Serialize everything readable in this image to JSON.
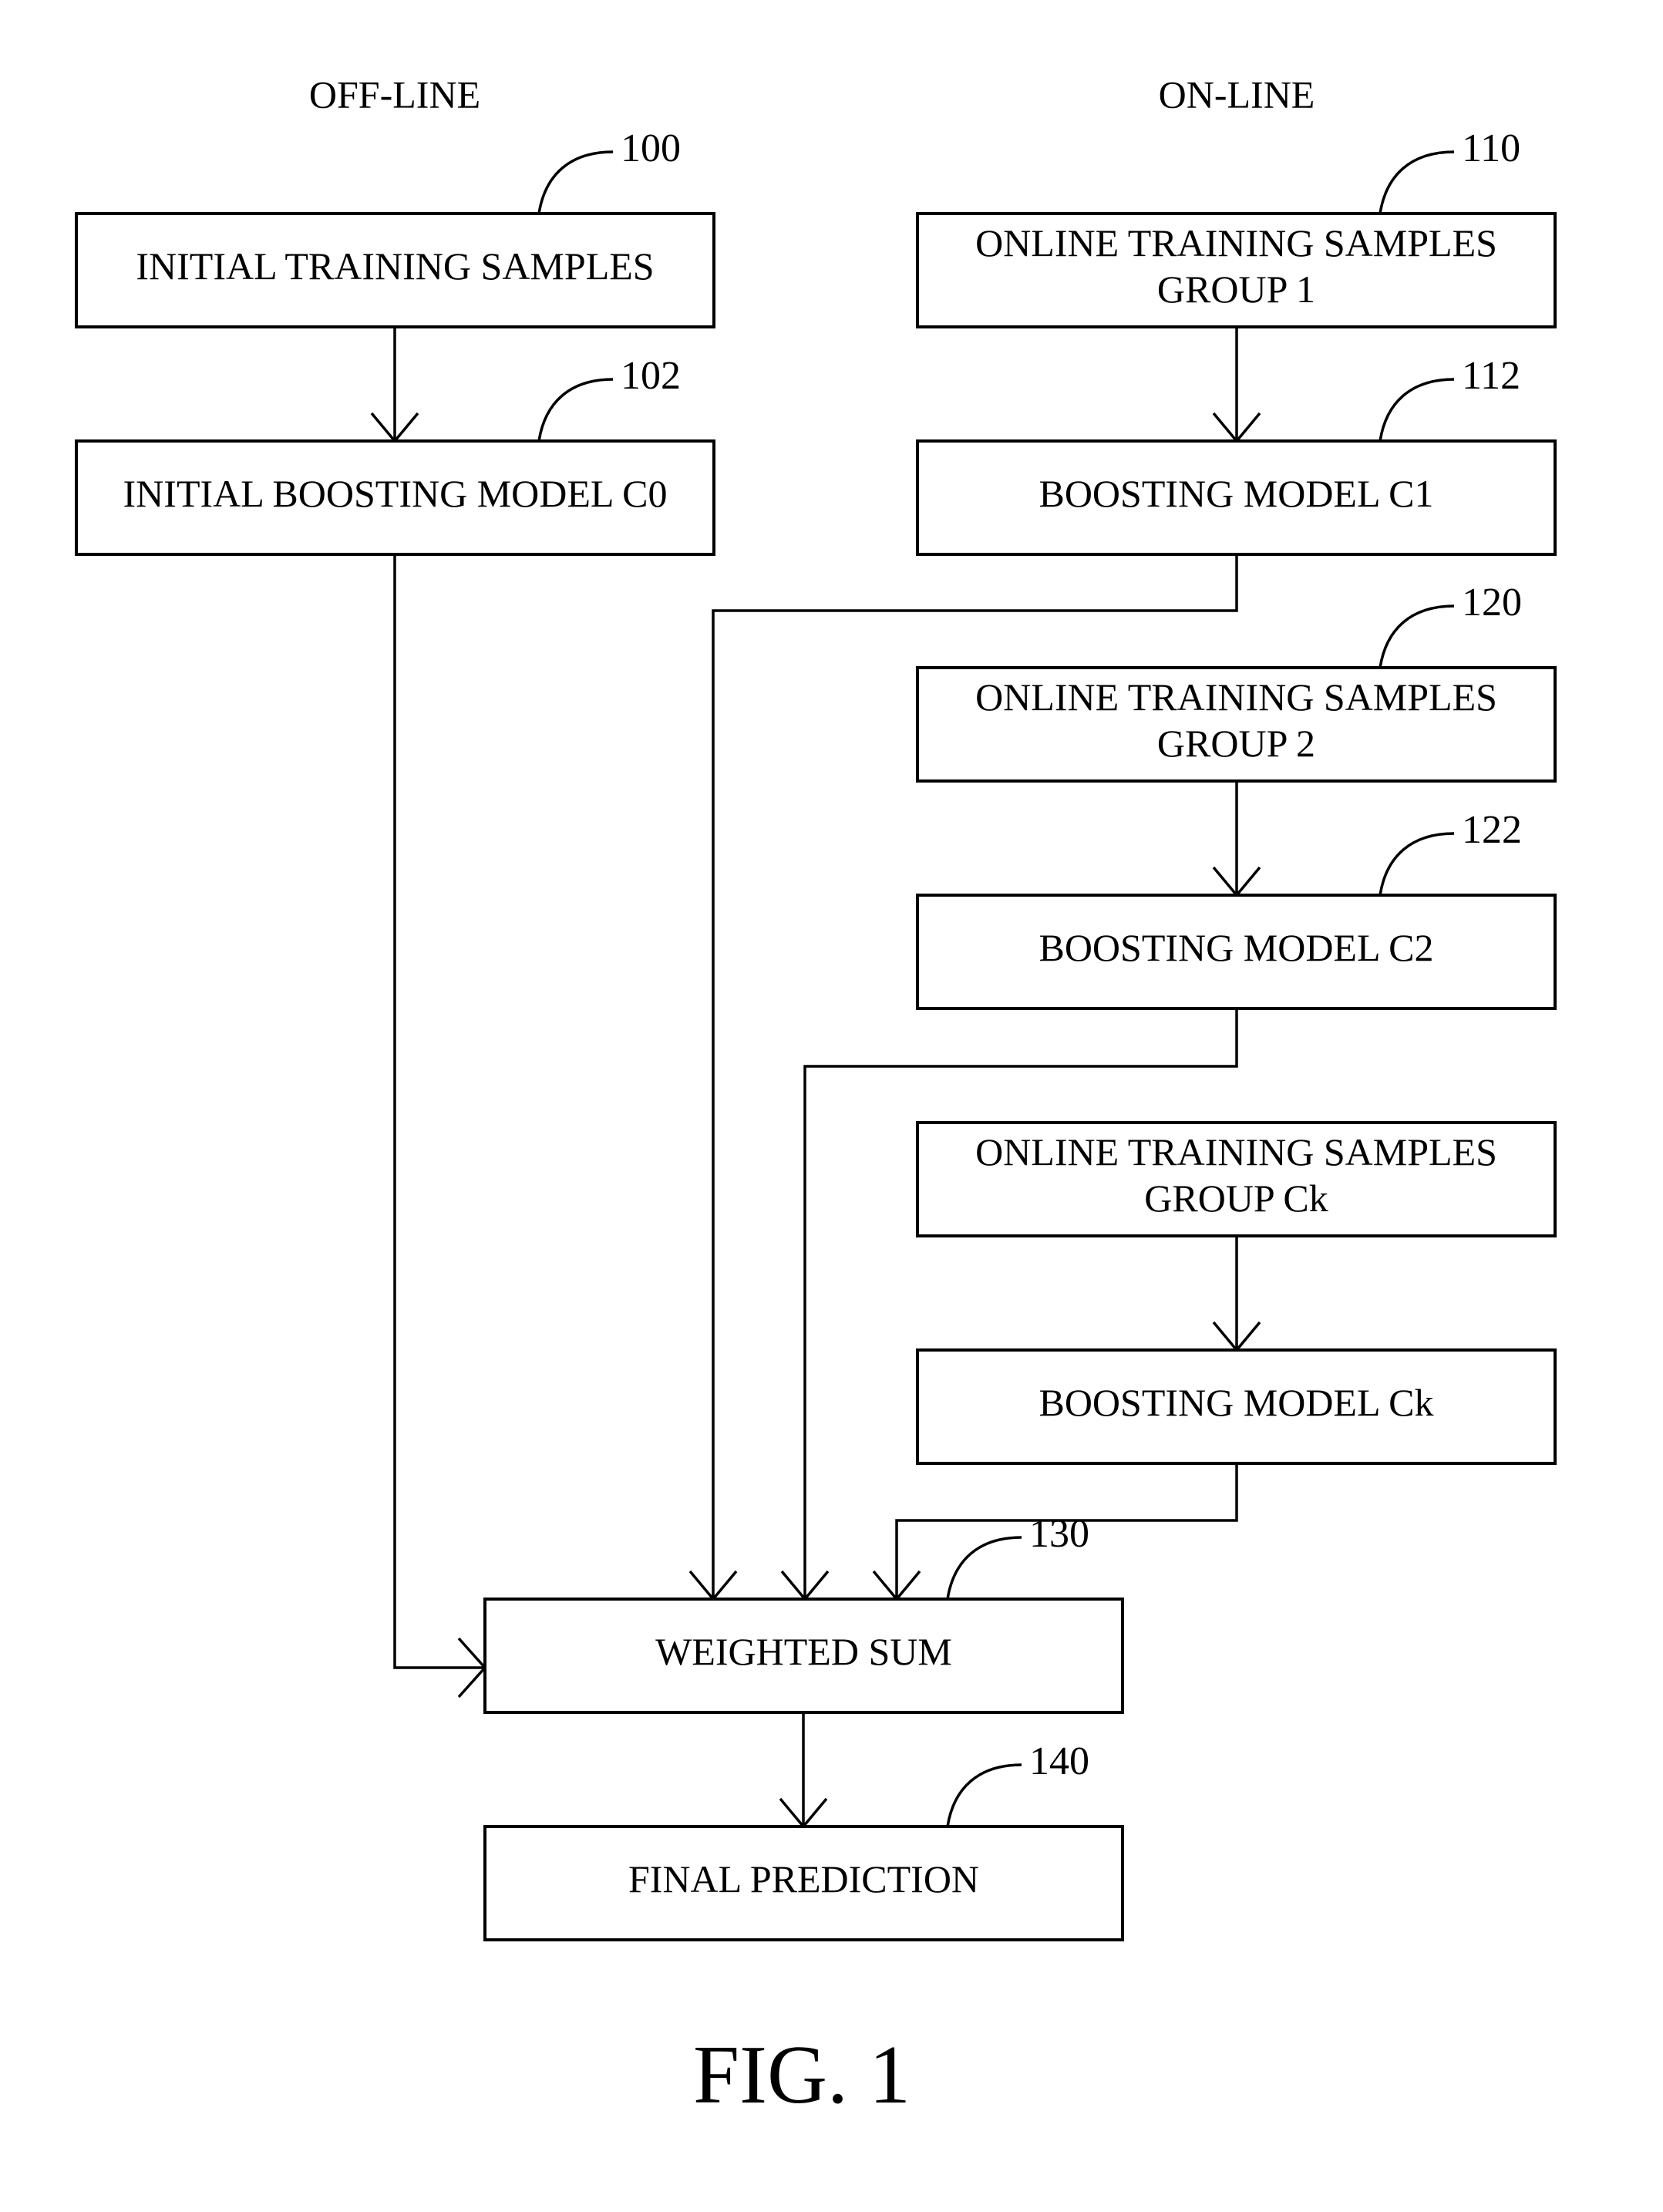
{
  "columns": {
    "offline": "OFF-LINE",
    "online": "ON-LINE"
  },
  "nodes": {
    "initial_training_samples": {
      "ref": "100",
      "lines": [
        "INITIAL TRAINING SAMPLES"
      ]
    },
    "initial_boosting_model": {
      "ref": "102",
      "lines": [
        "INITIAL BOOSTING MODEL C0"
      ]
    },
    "online_group_1": {
      "ref": "110",
      "lines": [
        "ONLINE TRAINING SAMPLES",
        "GROUP 1"
      ]
    },
    "boosting_model_c1": {
      "ref": "112",
      "lines": [
        "BOOSTING MODEL C1"
      ]
    },
    "online_group_2": {
      "ref": "120",
      "lines": [
        "ONLINE TRAINING SAMPLES",
        "GROUP 2"
      ]
    },
    "boosting_model_c2": {
      "ref": "122",
      "lines": [
        "BOOSTING MODEL C2"
      ]
    },
    "online_group_ck": {
      "ref": "",
      "lines": [
        "ONLINE TRAINING SAMPLES",
        "GROUP Ck"
      ]
    },
    "boosting_model_ck": {
      "ref": "",
      "lines": [
        "BOOSTING MODEL Ck"
      ]
    },
    "weighted_sum": {
      "ref": "130",
      "lines": [
        "WEIGHTED SUM"
      ]
    },
    "final_prediction": {
      "ref": "140",
      "lines": [
        "FINAL PREDICTION"
      ]
    }
  },
  "edges": [
    [
      "initial_training_samples",
      "initial_boosting_model"
    ],
    [
      "online_group_1",
      "boosting_model_c1"
    ],
    [
      "online_group_2",
      "boosting_model_c2"
    ],
    [
      "online_group_ck",
      "boosting_model_ck"
    ],
    [
      "initial_boosting_model",
      "weighted_sum"
    ],
    [
      "boosting_model_c1",
      "weighted_sum"
    ],
    [
      "boosting_model_c2",
      "weighted_sum"
    ],
    [
      "boosting_model_ck",
      "weighted_sum"
    ],
    [
      "weighted_sum",
      "final_prediction"
    ]
  ],
  "caption": "FIG. 1"
}
